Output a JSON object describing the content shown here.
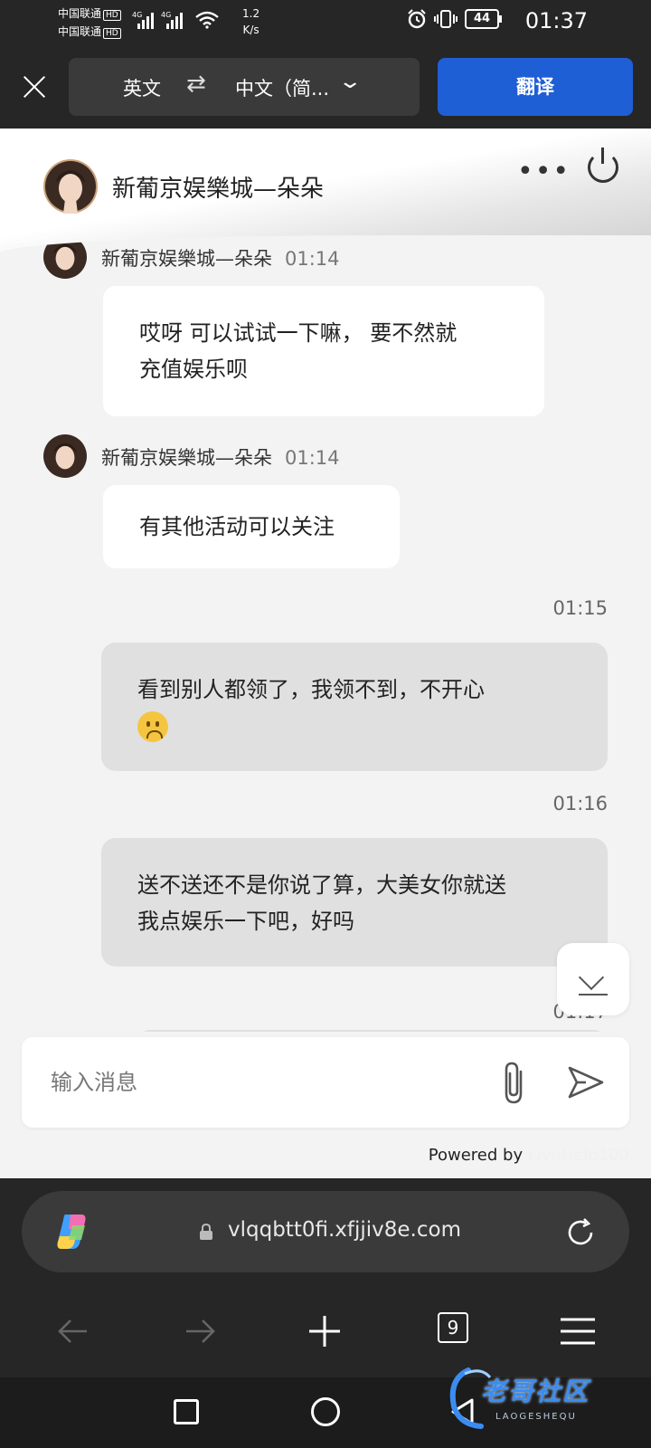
{
  "status_bar": {
    "carrier_1": "中国联通",
    "carrier_2": "中国联通",
    "hd_badge": "HD",
    "network_1": "4G",
    "network_2": "4G",
    "net_speed_value": "1.2",
    "net_speed_unit": "K/s",
    "battery": "44",
    "time": "01:37"
  },
  "translate_bar": {
    "source_lang": "英文",
    "swap_icon": "⇄",
    "target_lang": "中文（简...",
    "translate_label": "翻译"
  },
  "chat_header": {
    "title": "新葡京娱樂城—朵朵",
    "more_icon": "•••"
  },
  "messages": [
    {
      "sender": "新葡京娱樂城—朵朵",
      "time": "01:14",
      "lines": [
        "哎呀 可以试试一下嘛， 要不然就",
        "充值娱乐呗"
      ]
    },
    {
      "sender": "新葡京娱樂城—朵朵",
      "time": "01:14",
      "lines": [
        "有其他活动可以关注"
      ]
    },
    {
      "time": "01:15",
      "lines": [
        "看到别人都领了，我领不到，不开心"
      ],
      "emoji": "slightly-frowning-face"
    },
    {
      "time": "01:16",
      "lines": [
        "送不送还不是你说了算，大美女你就送",
        "我点娱乐一下吧，好吗"
      ]
    },
    {
      "time": "01:17"
    }
  ],
  "input": {
    "placeholder": "输入消息"
  },
  "powered": {
    "prefix": "Powered by",
    "brand": "LiveHelp100"
  },
  "browser": {
    "url": "vlqqbtt0fi.xfjjiv8e.com",
    "tabs_count": "9"
  },
  "watermark": {
    "text": "老哥社区",
    "sub": "LAOGESHEQU"
  },
  "colors": {
    "accent": "#1f5fd6",
    "dark_bar": "#262626",
    "chat_bg": "#f3f3f3",
    "bubble_out": "#e0e0e0"
  }
}
